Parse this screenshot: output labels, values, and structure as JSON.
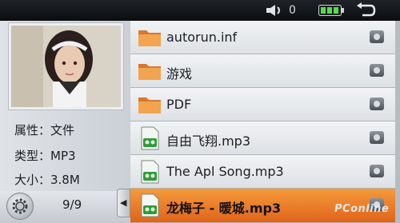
{
  "status": {
    "volume_level": "0"
  },
  "info": {
    "attribute": "属性：文件",
    "type": "类型：MP3",
    "size": "大小：3.8M",
    "page_counter": "9/9"
  },
  "files": [
    {
      "name": "autorun.inf",
      "icon": "folder-icon"
    },
    {
      "name": "游戏",
      "icon": "folder-icon"
    },
    {
      "name": "PDF",
      "icon": "folder-icon"
    },
    {
      "name": "自由飞翔.mp3",
      "icon": "music-file-icon"
    },
    {
      "name": "The Apl Song.mp3",
      "icon": "music-file-icon"
    },
    {
      "name": "龙梅子 - 暖城.mp3",
      "icon": "music-file-icon",
      "selected": true
    }
  ],
  "watermark": "PConline",
  "colors": {
    "selected_row": "#f08a30",
    "status_bar": "#14171b",
    "panel": "#d6dadf"
  }
}
